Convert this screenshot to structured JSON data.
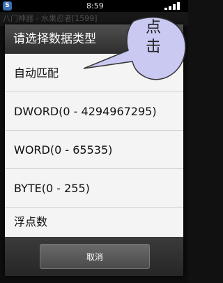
{
  "status_bar": {
    "time": "8:59",
    "app_icon": "S"
  },
  "background_app": {
    "title": "八门神器 - 水果忍者[1599]"
  },
  "dialog": {
    "title": "请选择数据类型",
    "options": [
      {
        "label": "自动匹配"
      },
      {
        "label": "DWORD(0 - 4294967295)"
      },
      {
        "label": "WORD(0 - 65535)"
      },
      {
        "label": "BYTE(0 - 255)"
      },
      {
        "label": "浮点数"
      }
    ],
    "cancel_label": "取消"
  },
  "annotation": {
    "text_line1": "点",
    "text_line2": "击",
    "fill_color": "#c9c9f2"
  },
  "icons": [
    "app-icon",
    "signal-icon"
  ]
}
